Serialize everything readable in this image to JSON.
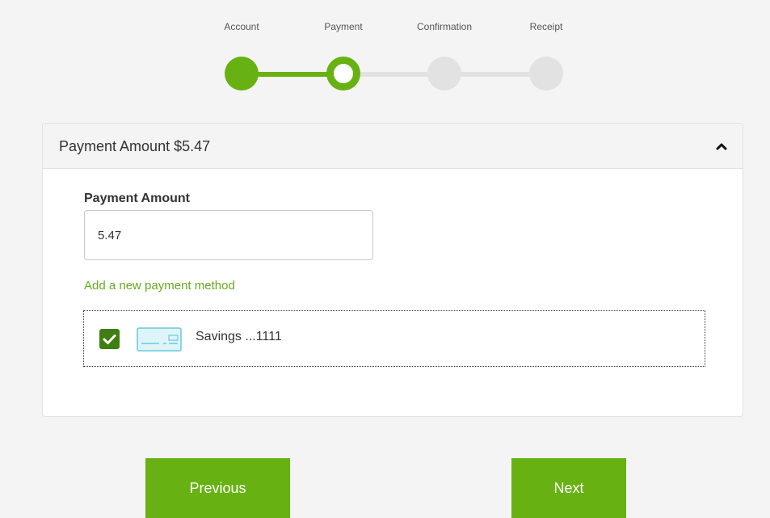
{
  "stepper": {
    "steps": [
      {
        "label": "Account",
        "state": "completed"
      },
      {
        "label": "Payment",
        "state": "current"
      },
      {
        "label": "Confirmation",
        "state": "upcoming"
      },
      {
        "label": "Receipt",
        "state": "upcoming"
      }
    ]
  },
  "panel": {
    "title": "Payment Amount $5.47",
    "collapse_icon": "chevron-up-icon"
  },
  "form": {
    "amount_label": "Payment Amount",
    "amount_value": "5.47",
    "add_method_link": "Add a new payment method",
    "methods": [
      {
        "label": "Savings ...1111",
        "selected": true,
        "icon": "bank-check-icon"
      }
    ]
  },
  "actions": {
    "previous_label": "Previous",
    "next_label": "Next"
  },
  "colors": {
    "accent": "#67b212",
    "accent_dark": "#3f7e12",
    "link": "#66aa1e",
    "inactive": "#e2e2e2",
    "background": "#f4f4f4"
  }
}
